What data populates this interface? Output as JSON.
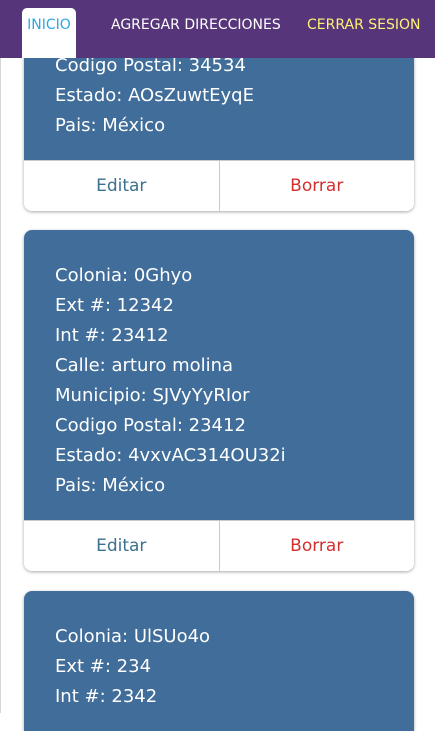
{
  "nav": {
    "tabs": [
      {
        "label": "INICIO",
        "active": true
      },
      {
        "label": "AGREGAR DIRECCIONES",
        "active": false
      },
      {
        "label": "CERRAR SESION",
        "active": false
      }
    ]
  },
  "colors": {
    "navbar": "#56357a",
    "card": "#406d99",
    "active_tab_text": "#2ea8e0",
    "logout_text": "#fff176",
    "edit_text": "#3a7290",
    "delete_text": "#d32f2f"
  },
  "cards": [
    {
      "fields": [
        "Codigo Postal: 34534",
        "Estado: AOsZuwtEyqE",
        "Pais: México"
      ],
      "edit_label": "Editar",
      "delete_label": "Borrar"
    },
    {
      "fields": [
        "Colonia: 0Ghyo",
        "Ext #: 12342",
        "Int #: 23412",
        "Calle: arturo molina",
        "Municipio: SJVyYyRIor",
        "Codigo Postal: 23412",
        "Estado: 4vxvAC314OU32i",
        "Pais: México"
      ],
      "edit_label": "Editar",
      "delete_label": "Borrar"
    },
    {
      "fields": [
        "Colonia: UlSUo4o",
        "Ext #: 234",
        "Int #: 2342"
      ]
    }
  ]
}
